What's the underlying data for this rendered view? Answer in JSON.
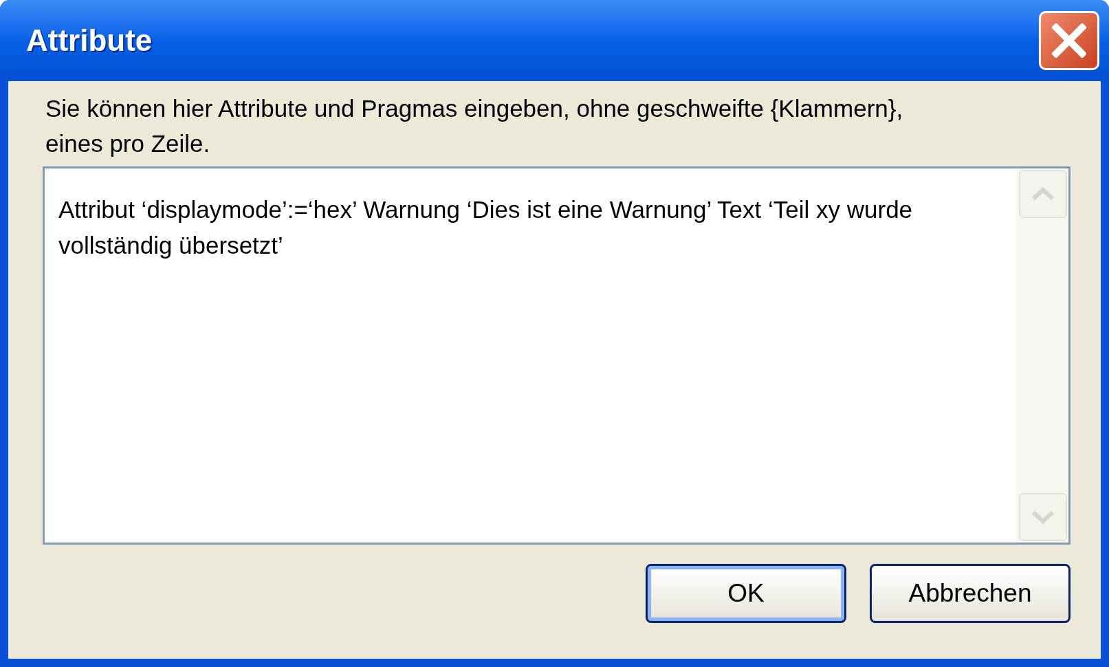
{
  "window": {
    "title": "Attribute"
  },
  "instructions": "Sie können hier Attribute und Pragmas eingeben, ohne geschweifte {Klammern}, eines pro Zeile.",
  "text_area": {
    "value": "Attribut ‘displaymode’:=‘hex’ Warnung ‘Dies ist eine Warnung’ Text ‘Teil xy wurde vollständig übersetzt’"
  },
  "buttons": [
    {
      "label": "OK",
      "default": true
    },
    {
      "label": "Abbrechen",
      "default": false
    }
  ]
}
